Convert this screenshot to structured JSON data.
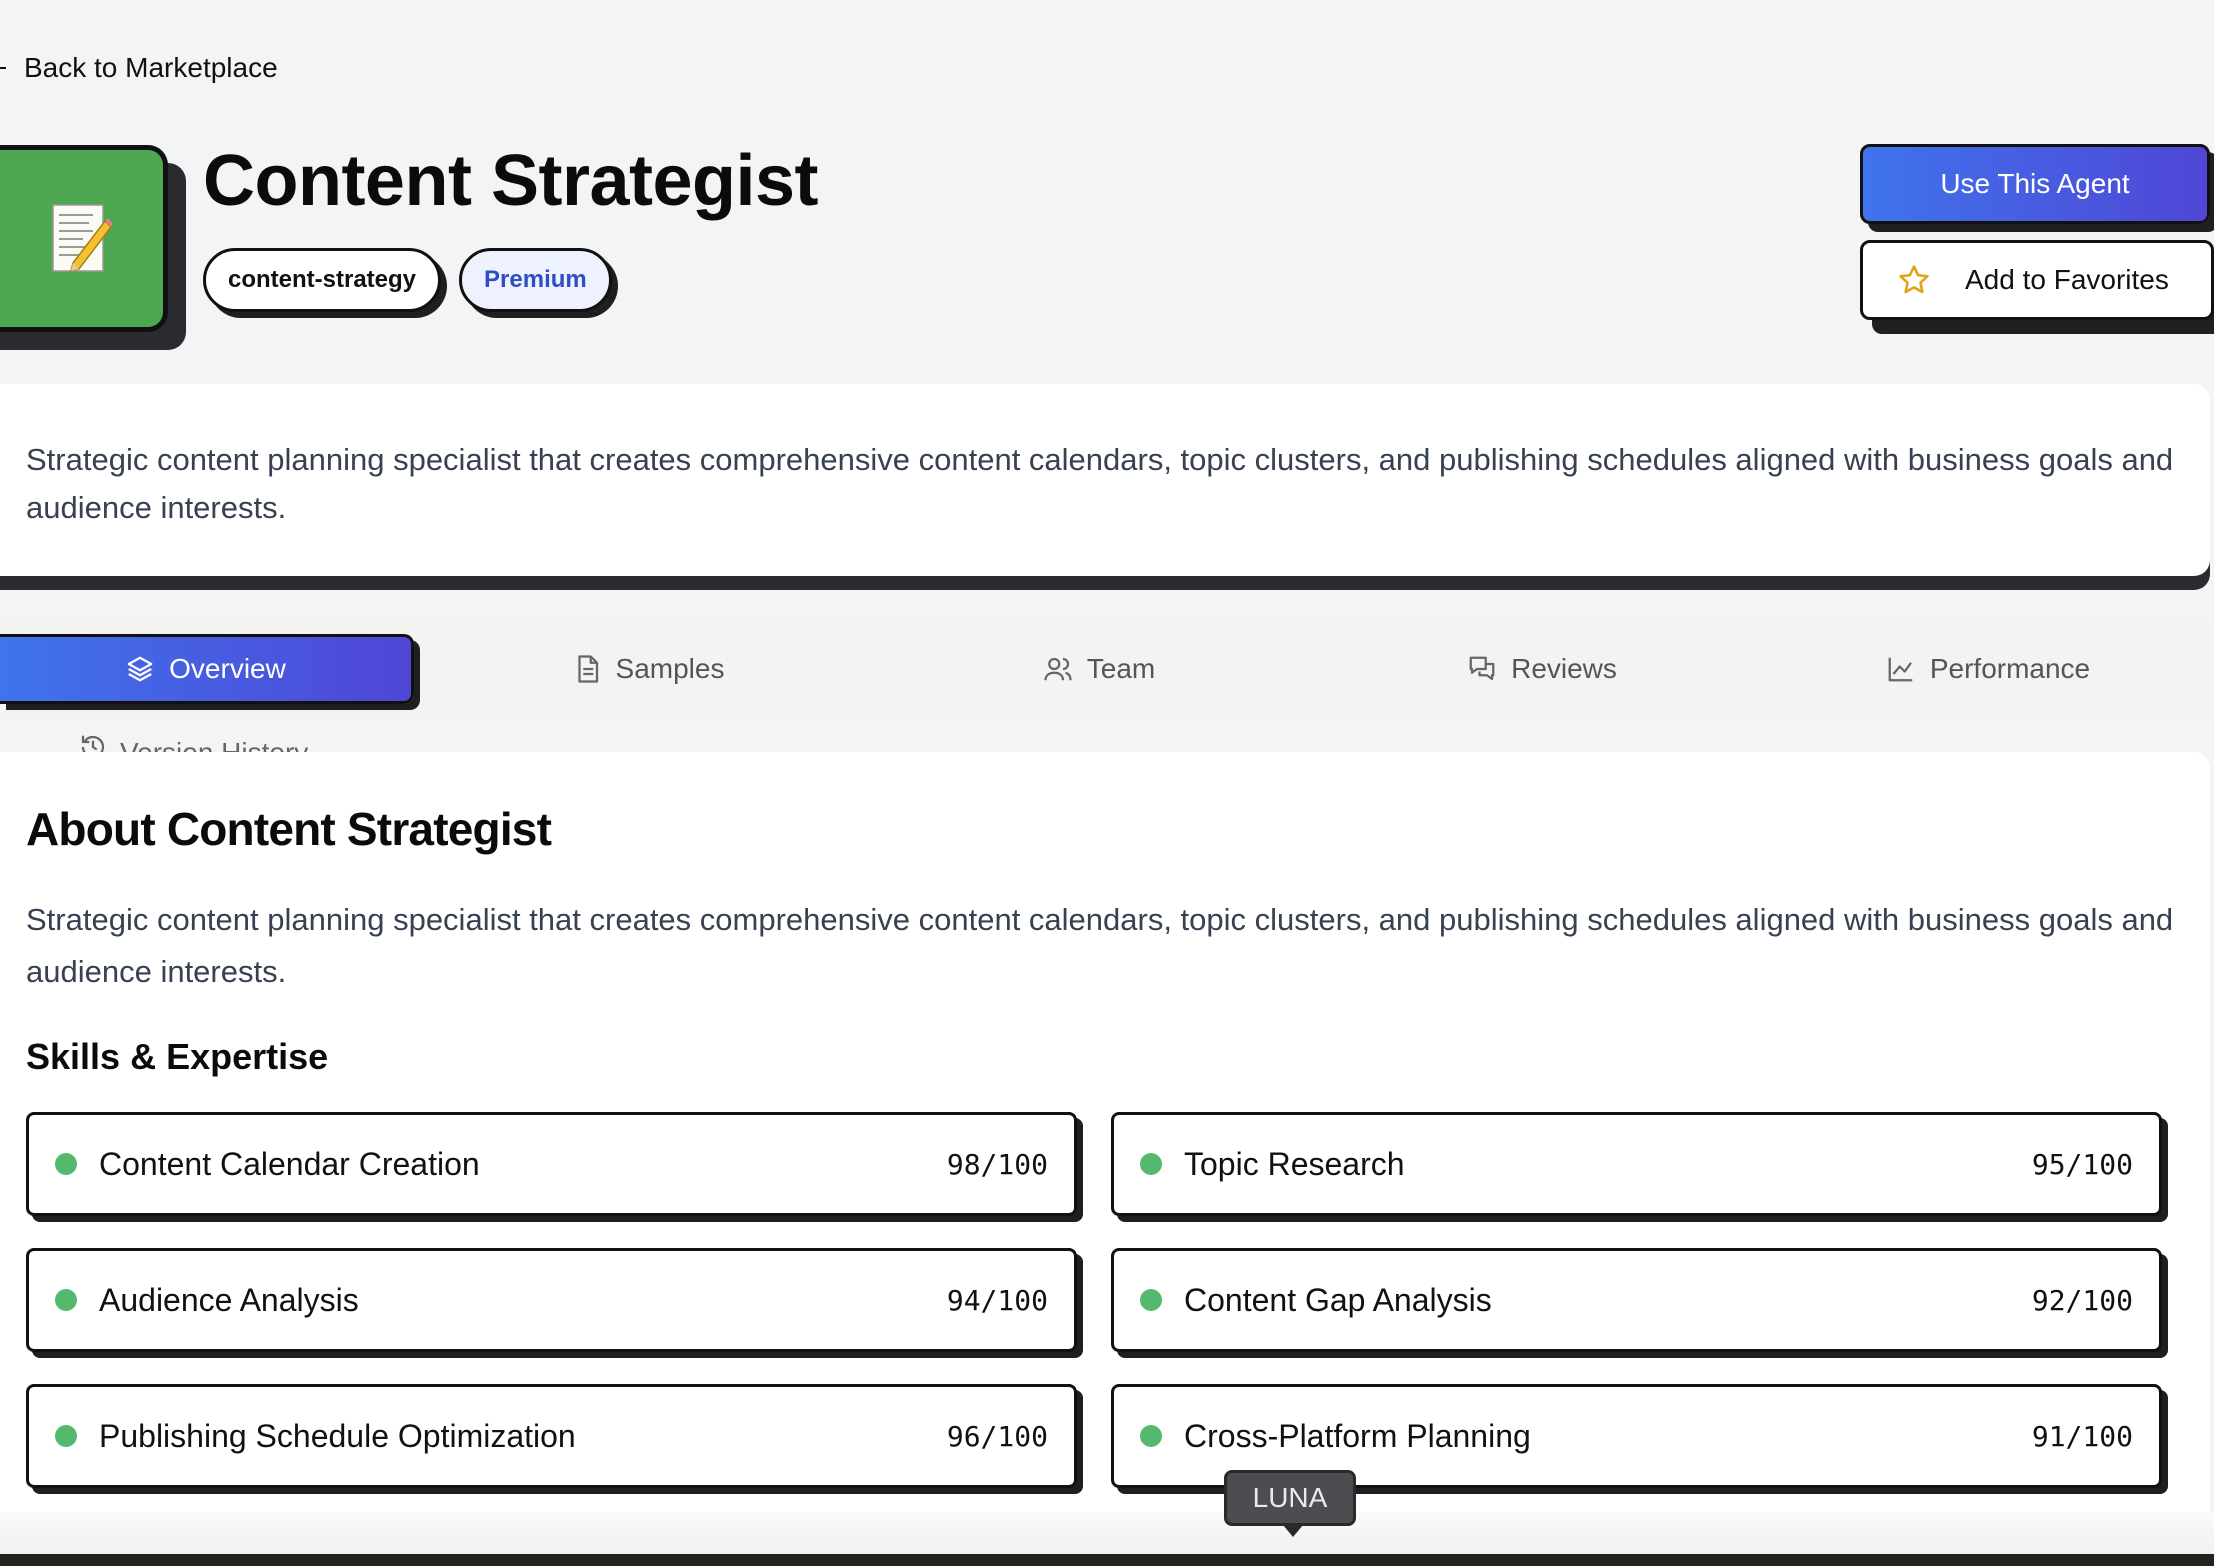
{
  "nav": {
    "back_label": "Back to Marketplace"
  },
  "agent": {
    "icon": "memo-icon",
    "icon_color": "#4ea751",
    "title": "Content Strategist",
    "tags": [
      "content-strategy",
      "Premium"
    ]
  },
  "actions": {
    "use_label": "Use This Agent",
    "favorite_label": "Add to Favorites",
    "favorite_icon": "star-icon",
    "primary_gradient": [
      "#3f74ec",
      "#4f46d6"
    ]
  },
  "description": "Strategic content planning specialist that creates comprehensive content calendars, topic clusters, and publishing schedules aligned with business goals and audience interests.",
  "tabs": [
    {
      "label": "Overview",
      "icon": "layers-icon",
      "active": true
    },
    {
      "label": "Samples",
      "icon": "document-icon",
      "active": false
    },
    {
      "label": "Team",
      "icon": "users-icon",
      "active": false
    },
    {
      "label": "Reviews",
      "icon": "chat-icon",
      "active": false
    },
    {
      "label": "Performance",
      "icon": "chart-icon",
      "active": false
    },
    {
      "label": "Version History",
      "icon": "history-icon",
      "active": false
    }
  ],
  "overview": {
    "heading": "About Content Strategist",
    "text": "Strategic content planning specialist that creates comprehensive content calendars, topic clusters, and publishing schedules aligned with business goals and audience interests.",
    "skills_heading": "Skills & Expertise",
    "skills": [
      {
        "name": "Content Calendar Creation",
        "score": "98/100"
      },
      {
        "name": "Topic Research",
        "score": "95/100"
      },
      {
        "name": "Audience Analysis",
        "score": "94/100"
      },
      {
        "name": "Content Gap Analysis",
        "score": "92/100"
      },
      {
        "name": "Publishing Schedule Optimization",
        "score": "96/100"
      },
      {
        "name": "Cross-Platform Planning",
        "score": "91/100"
      }
    ]
  },
  "tooltip": {
    "label": "LUNA"
  }
}
